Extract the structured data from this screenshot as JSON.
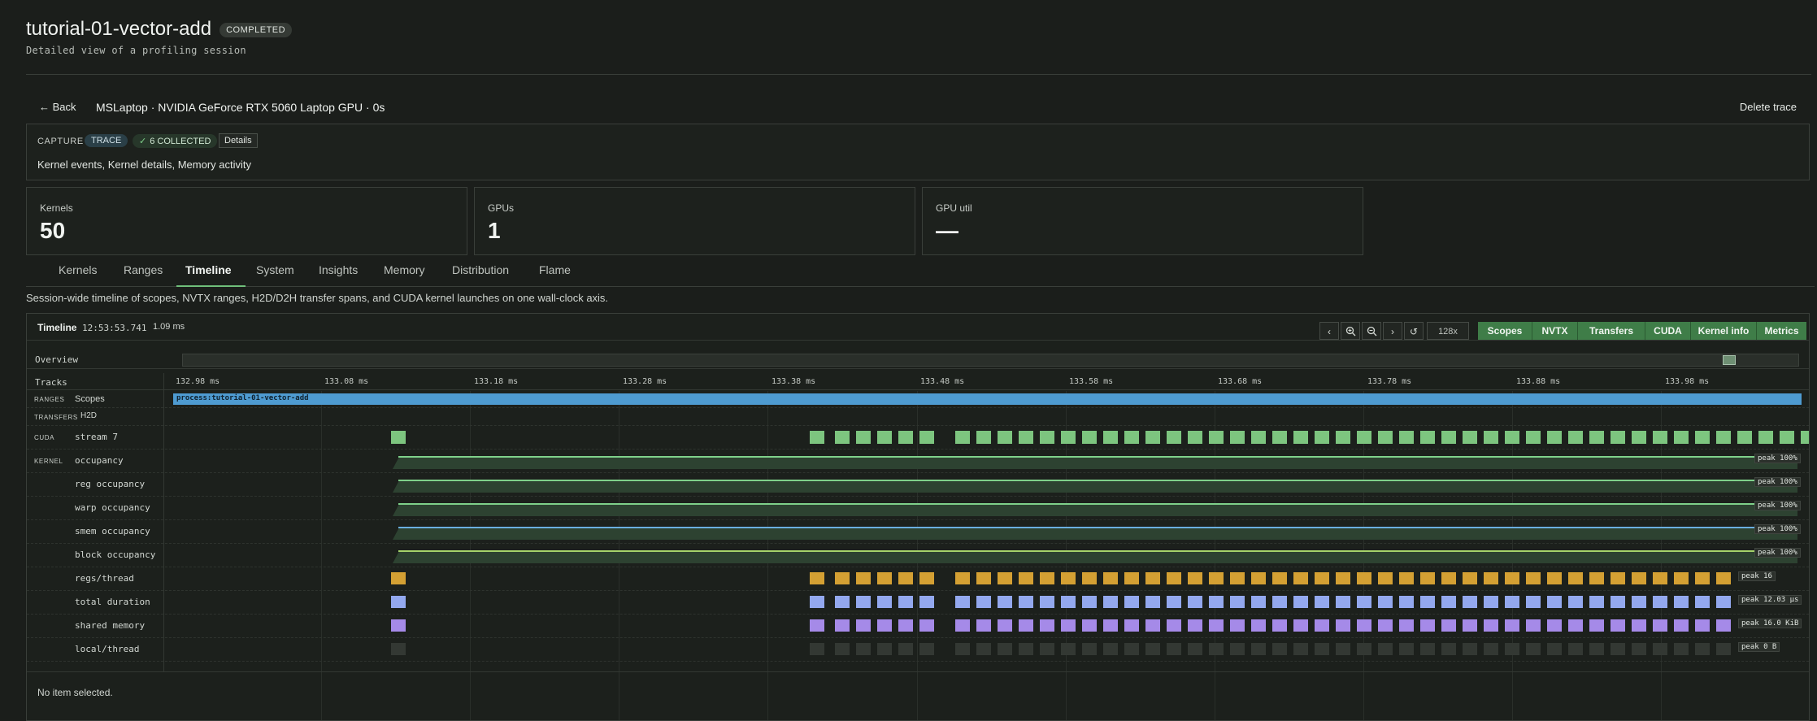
{
  "header": {
    "title": "tutorial-01-vector-add",
    "status": "COMPLETED",
    "subtitle": "Detailed view of a profiling session"
  },
  "nav": {
    "back_label": "← Back",
    "machine": "MSLaptop · NVIDIA GeForce RTX 5060 Laptop GPU · 0s",
    "delete_label": "Delete trace"
  },
  "capture": {
    "label": "CAPTURE",
    "mode": "TRACE",
    "collected": "6 COLLECTED",
    "details_label": "Details",
    "description": "Kernel events, Kernel details, Memory activity"
  },
  "stats": [
    {
      "label": "Kernels",
      "value": "50"
    },
    {
      "label": "GPUs",
      "value": "1"
    },
    {
      "label": "GPU util",
      "value": "—"
    }
  ],
  "tabs": [
    "Kernels",
    "Ranges",
    "Timeline",
    "System",
    "Insights",
    "Memory",
    "Distribution",
    "Flame"
  ],
  "active_tab": "Timeline",
  "description": "Session-wide timeline of scopes, NVTX ranges, H2D/D2H transfer spans, and CUDA kernel launches on one wall-clock axis.",
  "timeline": {
    "title": "Timeline",
    "start_time": "12:53:53.741",
    "duration": "1.09 ms",
    "zoom": "128x",
    "toggles": [
      "Scopes",
      "NVTX",
      "Transfers",
      "CUDA",
      "Kernel info",
      "Metrics"
    ],
    "overview_label": "Overview",
    "tracks_label": "Tracks",
    "ticks": [
      "132.98 ms",
      "133.08 ms",
      "133.18 ms",
      "133.28 ms",
      "133.38 ms",
      "133.48 ms",
      "133.58 ms",
      "133.68 ms",
      "133.78 ms",
      "133.88 ms",
      "133.98 ms"
    ],
    "scope_group": "RANGES",
    "scope_name": "Scopes",
    "scope_bar_label": "process:tutorial-01-vector-add",
    "transfer_group": "TRANSFERS",
    "transfer_name": "H2D",
    "cuda_group": "CUDA",
    "cuda_name": "stream 7",
    "kernel_group": "KERNEL",
    "occupancy_rows": [
      {
        "name": "occupancy",
        "peak": "peak 100%",
        "color": "#7fd08a"
      },
      {
        "name": "reg occupancy",
        "peak": "peak 100%",
        "color": "#7fd08a"
      },
      {
        "name": "warp occupancy",
        "peak": "peak 100%",
        "color": "#7fd08a"
      },
      {
        "name": "smem occupancy",
        "peak": "peak 100%",
        "color": "#6aaee0"
      },
      {
        "name": "block occupancy",
        "peak": "peak 100%",
        "color": "#a6d36a"
      }
    ],
    "marker_rows": [
      {
        "name": "regs/thread",
        "peak": "peak 16",
        "color": "#d4a033"
      },
      {
        "name": "total duration",
        "peak": "peak 12.03 µs",
        "color": "#93a8ee"
      },
      {
        "name": "shared memory",
        "peak": "peak 16.0 KiB",
        "color": "#a58ae8"
      },
      {
        "name": "local/thread",
        "peak": "peak 0 B",
        "color": "#333833"
      }
    ],
    "cuda_color": "#7dc57f",
    "footer": "No item selected."
  }
}
